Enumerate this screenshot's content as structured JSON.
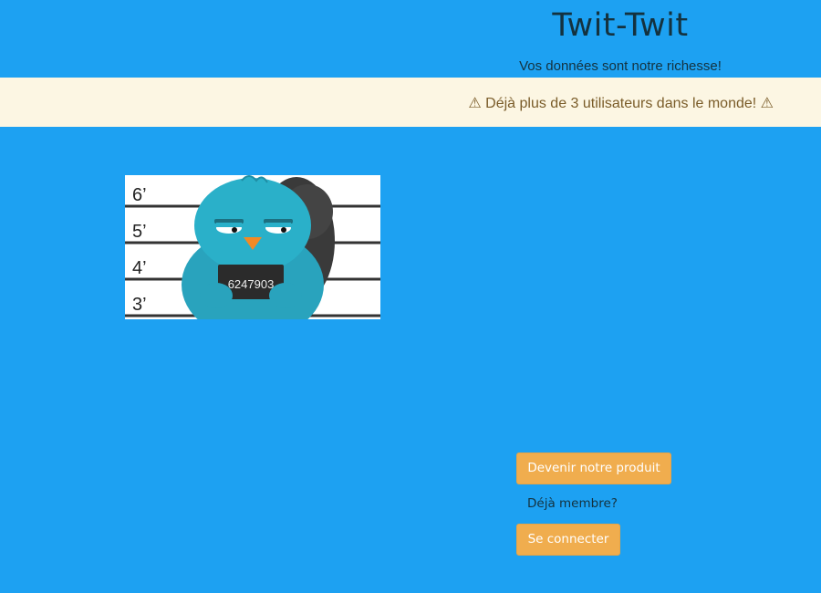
{
  "header": {
    "title": "Twit-Twit",
    "tagline": "Vos données sont notre richesse!"
  },
  "warning": {
    "text": "⚠ Déjà plus de 3 utilisateurs dans le monde! ⚠"
  },
  "mugshot": {
    "height_labels": [
      "6’",
      "5’",
      "4’",
      "3’"
    ],
    "placard_number": "6247903"
  },
  "actions": {
    "signup_label": "Devenir notre produit",
    "member_prompt": "Déjà membre?",
    "login_label": "Se connecter"
  },
  "colors": {
    "background": "#1da1f2",
    "warning_background": "#fcf6e3",
    "button": "#f0ad4e"
  }
}
